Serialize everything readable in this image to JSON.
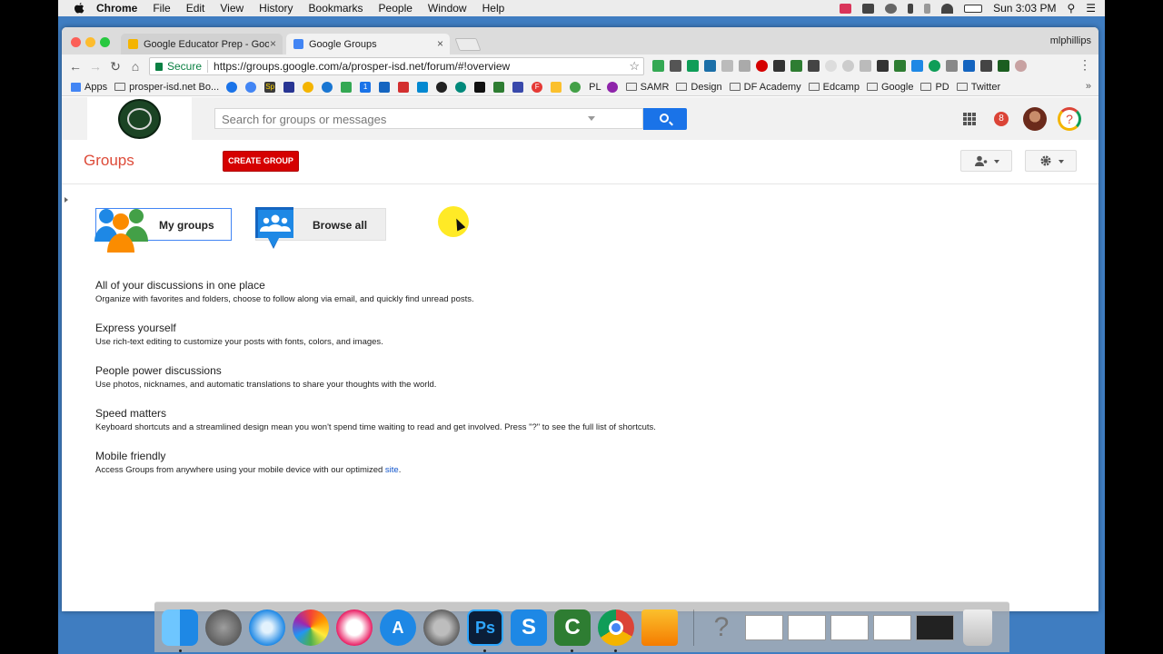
{
  "menubar": {
    "app": "Chrome",
    "items": [
      "File",
      "Edit",
      "View",
      "History",
      "Bookmarks",
      "People",
      "Window",
      "Help"
    ],
    "clock": "Sun 3:03 PM"
  },
  "browser": {
    "tabs": [
      {
        "title": "Google Educator Prep - Googl",
        "close": "×",
        "favicon_color": "#f4b400"
      },
      {
        "title": "Google Groups",
        "close": "×",
        "favicon_color": "#4285f4"
      }
    ],
    "profile": "mlphillips",
    "secure_label": "Secure",
    "url": "https://groups.google.com/a/prosper-isd.net/forum/#!overview",
    "bookmarks": [
      {
        "label": "Apps",
        "type": "apps"
      },
      {
        "label": "prosper-isd.net Bo...",
        "type": "folder"
      },
      {
        "label": "SAMR",
        "type": "folder"
      },
      {
        "label": "Design",
        "type": "folder"
      },
      {
        "label": "DF Academy",
        "type": "folder"
      },
      {
        "label": "Edcamp",
        "type": "folder"
      },
      {
        "label": "Google",
        "type": "folder"
      },
      {
        "label": "PD",
        "type": "folder"
      },
      {
        "label": "Twitter",
        "type": "folder"
      }
    ],
    "bookmark_icon_labels": [
      "Sp",
      "1",
      "F",
      "PL"
    ],
    "overflow": "»"
  },
  "groups": {
    "search_placeholder": "Search for groups or messages",
    "notification_count": "8",
    "help_glyph": "?",
    "title": "Groups",
    "create_button": "CREATE GROUP",
    "tiles": {
      "my_groups": "My groups",
      "browse_all": "Browse all"
    },
    "features": [
      {
        "title": "All of your discussions in one place",
        "desc": "Organize with favorites and folders, choose to follow along via email, and quickly find unread posts."
      },
      {
        "title": "Express yourself",
        "desc": "Use rich-text editing to customize your posts with fonts, colors, and images."
      },
      {
        "title": "People power discussions",
        "desc": "Use photos, nicknames, and automatic translations to share your thoughts with the world."
      },
      {
        "title": "Speed matters",
        "desc": "Keyboard shortcuts and a streamlined design mean you won't spend time waiting to read and get involved. Press \"?\" to see the full list of shortcuts."
      },
      {
        "title": "Mobile friendly",
        "desc_prefix": "Access Groups from anywhere using your mobile device with our optimized ",
        "link": "site",
        "desc_suffix": "."
      }
    ]
  },
  "dock": {
    "apps": [
      "finder-icon",
      "launchpad-icon",
      "safari-icon",
      "photos-icon",
      "itunes-icon",
      "app-store-icon",
      "system-preferences-icon",
      "photoshop-icon",
      "snagit-icon",
      "camtasia-icon",
      "chrome-icon",
      "downloads-icon",
      "help-icon"
    ],
    "photoshop_label": "Ps",
    "snagit_label": "S",
    "camtasia_label": "C",
    "help_label": "?"
  },
  "colors": {
    "accent_red": "#dd4b39",
    "create_red": "#d50000",
    "search_blue": "#1a73e8",
    "link_blue": "#1155cc"
  }
}
